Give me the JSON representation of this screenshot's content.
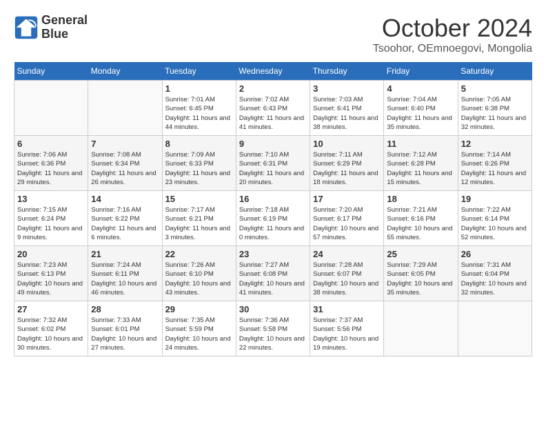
{
  "header": {
    "logo_line1": "General",
    "logo_line2": "Blue",
    "month": "October 2024",
    "location": "Tsoohor, OEmnoegovi, Mongolia"
  },
  "weekdays": [
    "Sunday",
    "Monday",
    "Tuesday",
    "Wednesday",
    "Thursday",
    "Friday",
    "Saturday"
  ],
  "weeks": [
    [
      {
        "day": "",
        "sunrise": "",
        "sunset": "",
        "daylight": ""
      },
      {
        "day": "",
        "sunrise": "",
        "sunset": "",
        "daylight": ""
      },
      {
        "day": "1",
        "sunrise": "Sunrise: 7:01 AM",
        "sunset": "Sunset: 6:45 PM",
        "daylight": "Daylight: 11 hours and 44 minutes."
      },
      {
        "day": "2",
        "sunrise": "Sunrise: 7:02 AM",
        "sunset": "Sunset: 6:43 PM",
        "daylight": "Daylight: 11 hours and 41 minutes."
      },
      {
        "day": "3",
        "sunrise": "Sunrise: 7:03 AM",
        "sunset": "Sunset: 6:41 PM",
        "daylight": "Daylight: 11 hours and 38 minutes."
      },
      {
        "day": "4",
        "sunrise": "Sunrise: 7:04 AM",
        "sunset": "Sunset: 6:40 PM",
        "daylight": "Daylight: 11 hours and 35 minutes."
      },
      {
        "day": "5",
        "sunrise": "Sunrise: 7:05 AM",
        "sunset": "Sunset: 6:38 PM",
        "daylight": "Daylight: 11 hours and 32 minutes."
      }
    ],
    [
      {
        "day": "6",
        "sunrise": "Sunrise: 7:06 AM",
        "sunset": "Sunset: 6:36 PM",
        "daylight": "Daylight: 11 hours and 29 minutes."
      },
      {
        "day": "7",
        "sunrise": "Sunrise: 7:08 AM",
        "sunset": "Sunset: 6:34 PM",
        "daylight": "Daylight: 11 hours and 26 minutes."
      },
      {
        "day": "8",
        "sunrise": "Sunrise: 7:09 AM",
        "sunset": "Sunset: 6:33 PM",
        "daylight": "Daylight: 11 hours and 23 minutes."
      },
      {
        "day": "9",
        "sunrise": "Sunrise: 7:10 AM",
        "sunset": "Sunset: 6:31 PM",
        "daylight": "Daylight: 11 hours and 20 minutes."
      },
      {
        "day": "10",
        "sunrise": "Sunrise: 7:11 AM",
        "sunset": "Sunset: 6:29 PM",
        "daylight": "Daylight: 11 hours and 18 minutes."
      },
      {
        "day": "11",
        "sunrise": "Sunrise: 7:12 AM",
        "sunset": "Sunset: 6:28 PM",
        "daylight": "Daylight: 11 hours and 15 minutes."
      },
      {
        "day": "12",
        "sunrise": "Sunrise: 7:14 AM",
        "sunset": "Sunset: 6:26 PM",
        "daylight": "Daylight: 11 hours and 12 minutes."
      }
    ],
    [
      {
        "day": "13",
        "sunrise": "Sunrise: 7:15 AM",
        "sunset": "Sunset: 6:24 PM",
        "daylight": "Daylight: 11 hours and 9 minutes."
      },
      {
        "day": "14",
        "sunrise": "Sunrise: 7:16 AM",
        "sunset": "Sunset: 6:22 PM",
        "daylight": "Daylight: 11 hours and 6 minutes."
      },
      {
        "day": "15",
        "sunrise": "Sunrise: 7:17 AM",
        "sunset": "Sunset: 6:21 PM",
        "daylight": "Daylight: 11 hours and 3 minutes."
      },
      {
        "day": "16",
        "sunrise": "Sunrise: 7:18 AM",
        "sunset": "Sunset: 6:19 PM",
        "daylight": "Daylight: 11 hours and 0 minutes."
      },
      {
        "day": "17",
        "sunrise": "Sunrise: 7:20 AM",
        "sunset": "Sunset: 6:17 PM",
        "daylight": "Daylight: 10 hours and 57 minutes."
      },
      {
        "day": "18",
        "sunrise": "Sunrise: 7:21 AM",
        "sunset": "Sunset: 6:16 PM",
        "daylight": "Daylight: 10 hours and 55 minutes."
      },
      {
        "day": "19",
        "sunrise": "Sunrise: 7:22 AM",
        "sunset": "Sunset: 6:14 PM",
        "daylight": "Daylight: 10 hours and 52 minutes."
      }
    ],
    [
      {
        "day": "20",
        "sunrise": "Sunrise: 7:23 AM",
        "sunset": "Sunset: 6:13 PM",
        "daylight": "Daylight: 10 hours and 49 minutes."
      },
      {
        "day": "21",
        "sunrise": "Sunrise: 7:24 AM",
        "sunset": "Sunset: 6:11 PM",
        "daylight": "Daylight: 10 hours and 46 minutes."
      },
      {
        "day": "22",
        "sunrise": "Sunrise: 7:26 AM",
        "sunset": "Sunset: 6:10 PM",
        "daylight": "Daylight: 10 hours and 43 minutes."
      },
      {
        "day": "23",
        "sunrise": "Sunrise: 7:27 AM",
        "sunset": "Sunset: 6:08 PM",
        "daylight": "Daylight: 10 hours and 41 minutes."
      },
      {
        "day": "24",
        "sunrise": "Sunrise: 7:28 AM",
        "sunset": "Sunset: 6:07 PM",
        "daylight": "Daylight: 10 hours and 38 minutes."
      },
      {
        "day": "25",
        "sunrise": "Sunrise: 7:29 AM",
        "sunset": "Sunset: 6:05 PM",
        "daylight": "Daylight: 10 hours and 35 minutes."
      },
      {
        "day": "26",
        "sunrise": "Sunrise: 7:31 AM",
        "sunset": "Sunset: 6:04 PM",
        "daylight": "Daylight: 10 hours and 32 minutes."
      }
    ],
    [
      {
        "day": "27",
        "sunrise": "Sunrise: 7:32 AM",
        "sunset": "Sunset: 6:02 PM",
        "daylight": "Daylight: 10 hours and 30 minutes."
      },
      {
        "day": "28",
        "sunrise": "Sunrise: 7:33 AM",
        "sunset": "Sunset: 6:01 PM",
        "daylight": "Daylight: 10 hours and 27 minutes."
      },
      {
        "day": "29",
        "sunrise": "Sunrise: 7:35 AM",
        "sunset": "Sunset: 5:59 PM",
        "daylight": "Daylight: 10 hours and 24 minutes."
      },
      {
        "day": "30",
        "sunrise": "Sunrise: 7:36 AM",
        "sunset": "Sunset: 5:58 PM",
        "daylight": "Daylight: 10 hours and 22 minutes."
      },
      {
        "day": "31",
        "sunrise": "Sunrise: 7:37 AM",
        "sunset": "Sunset: 5:56 PM",
        "daylight": "Daylight: 10 hours and 19 minutes."
      },
      {
        "day": "",
        "sunrise": "",
        "sunset": "",
        "daylight": ""
      },
      {
        "day": "",
        "sunrise": "",
        "sunset": "",
        "daylight": ""
      }
    ]
  ]
}
